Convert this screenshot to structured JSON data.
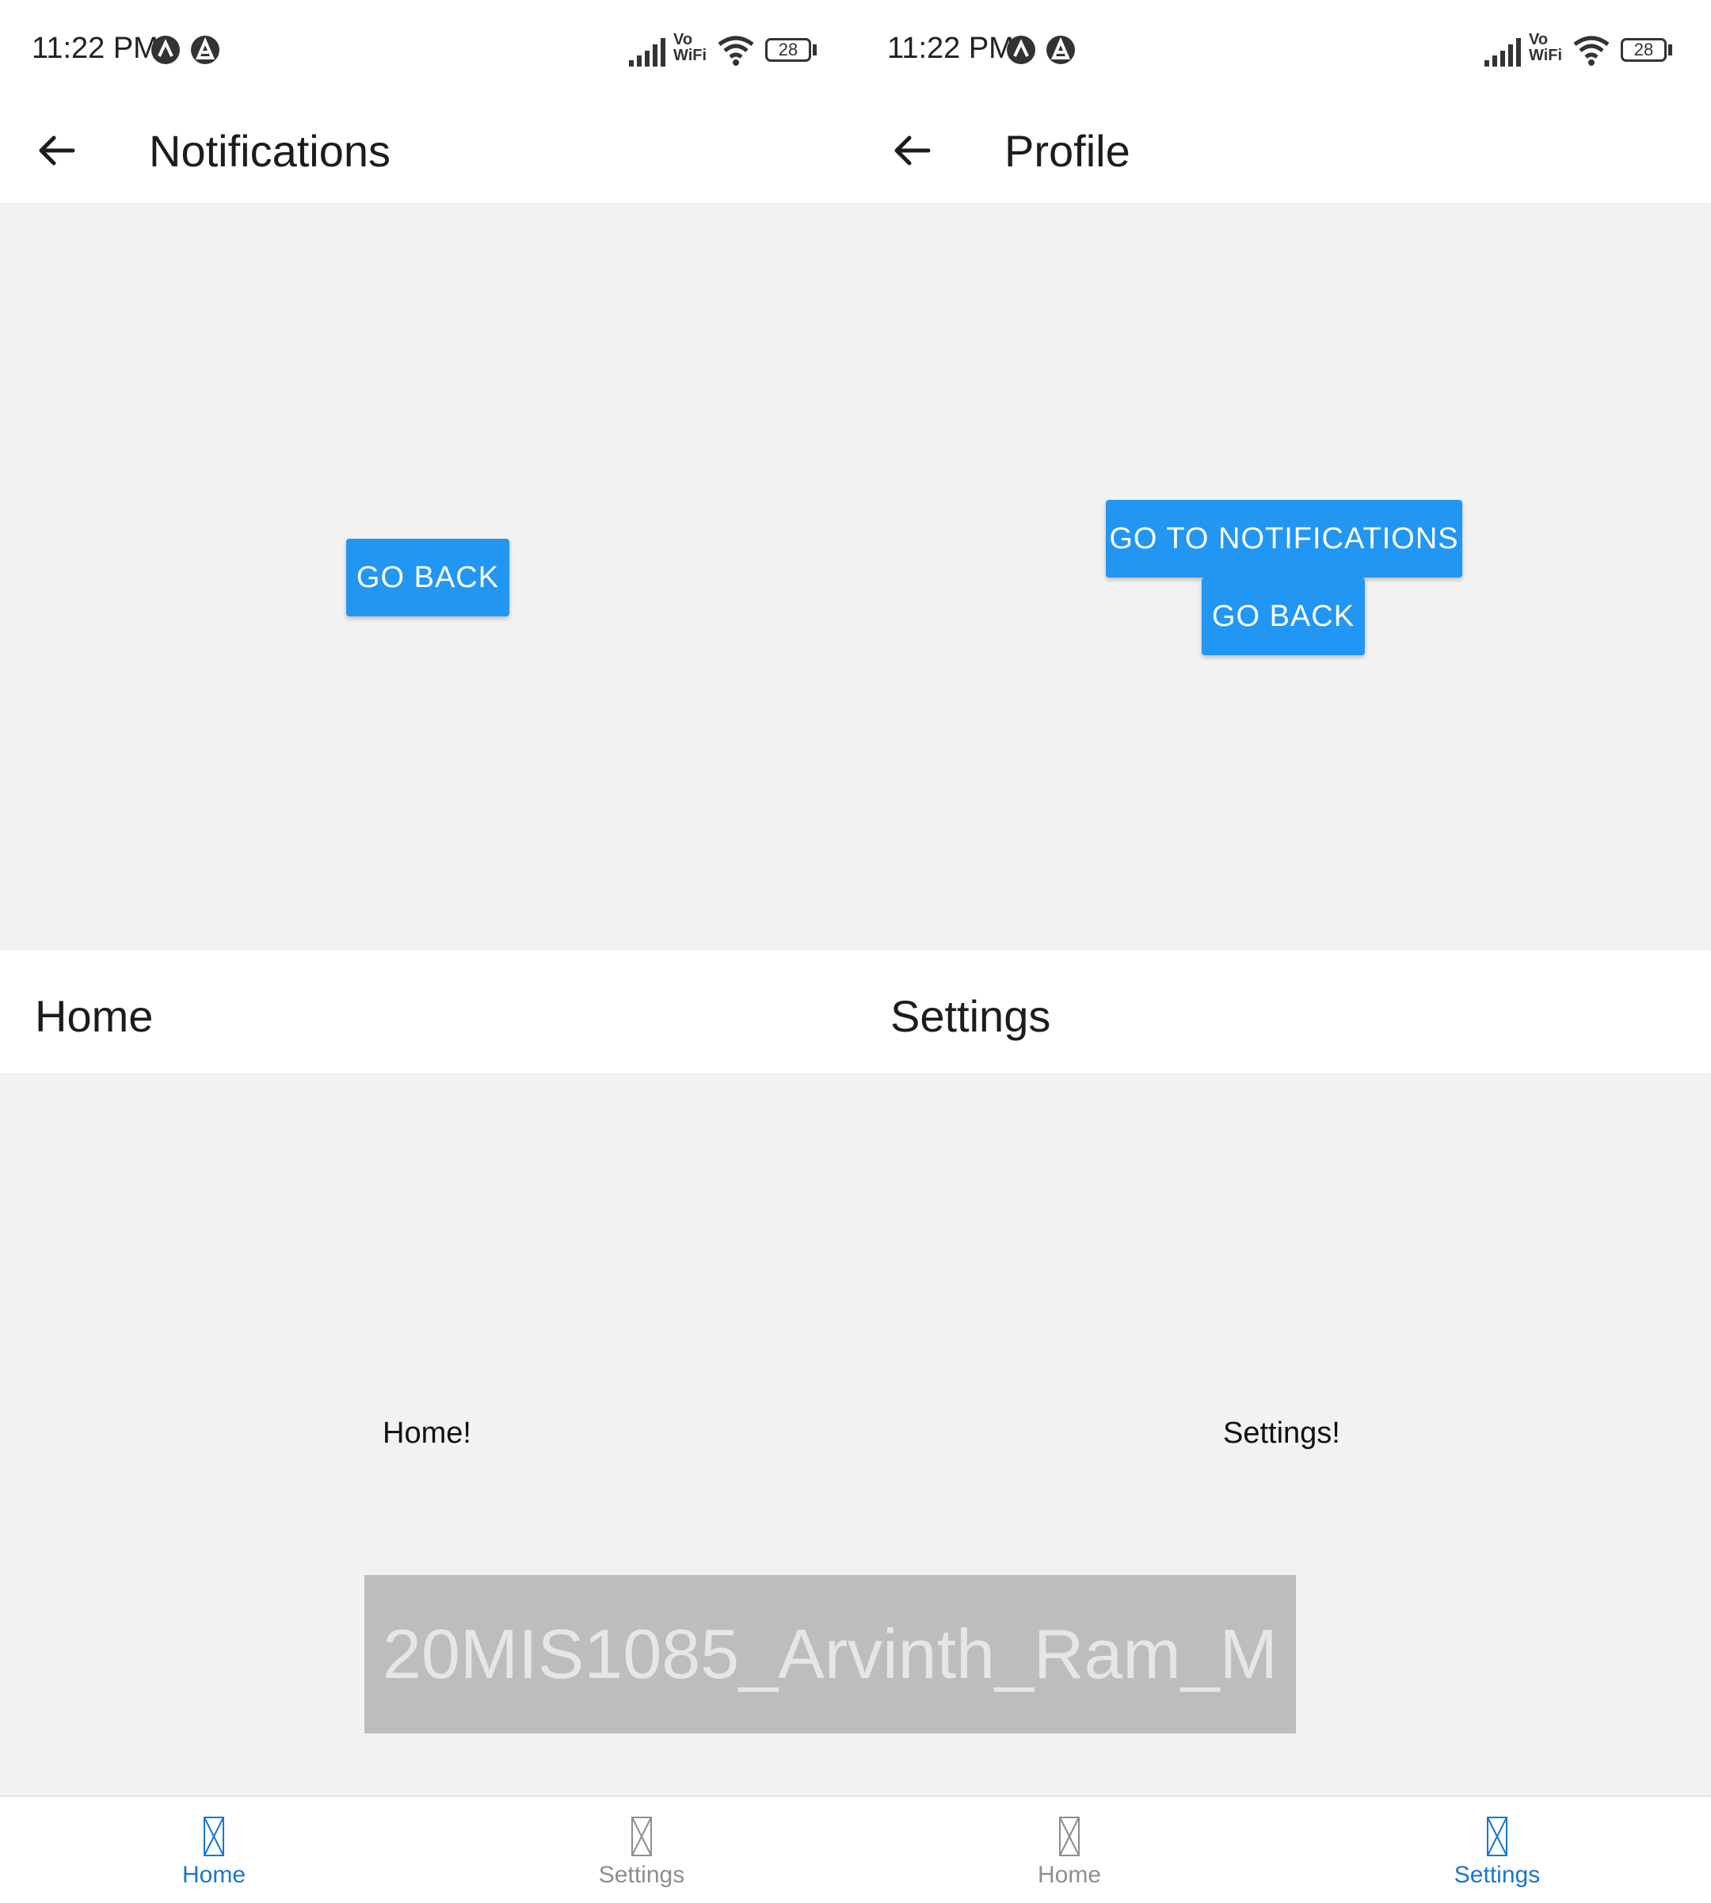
{
  "left": {
    "status": {
      "time": "11:22 PM",
      "battery": "28",
      "network_label_top": "Vo",
      "network_label_bottom": "WiFi"
    },
    "stack_screen": {
      "title": "Notifications",
      "buttons": [
        "GO BACK"
      ]
    },
    "tab_screen": {
      "title": "Home",
      "body": "Home!"
    },
    "tabs": [
      {
        "label": "Home",
        "active": true
      },
      {
        "label": "Settings",
        "active": false
      }
    ]
  },
  "right": {
    "status": {
      "time": "11:22 PM",
      "battery": "28",
      "network_label_top": "Vo",
      "network_label_bottom": "WiFi"
    },
    "stack_screen": {
      "title": "Profile",
      "buttons": [
        "GO TO NOTIFICATIONS",
        "GO BACK"
      ]
    },
    "tab_screen": {
      "title": "Settings",
      "body": "Settings!"
    },
    "tabs": [
      {
        "label": "Home",
        "active": false
      },
      {
        "label": "Settings",
        "active": true
      }
    ]
  },
  "watermark": "20MIS1085_Arvinth_Ram_M",
  "colors": {
    "accent": "#2196f3",
    "active_tab": "#1976d2",
    "inactive_tab": "#8e8e8e",
    "background": "#f2f2f2"
  }
}
